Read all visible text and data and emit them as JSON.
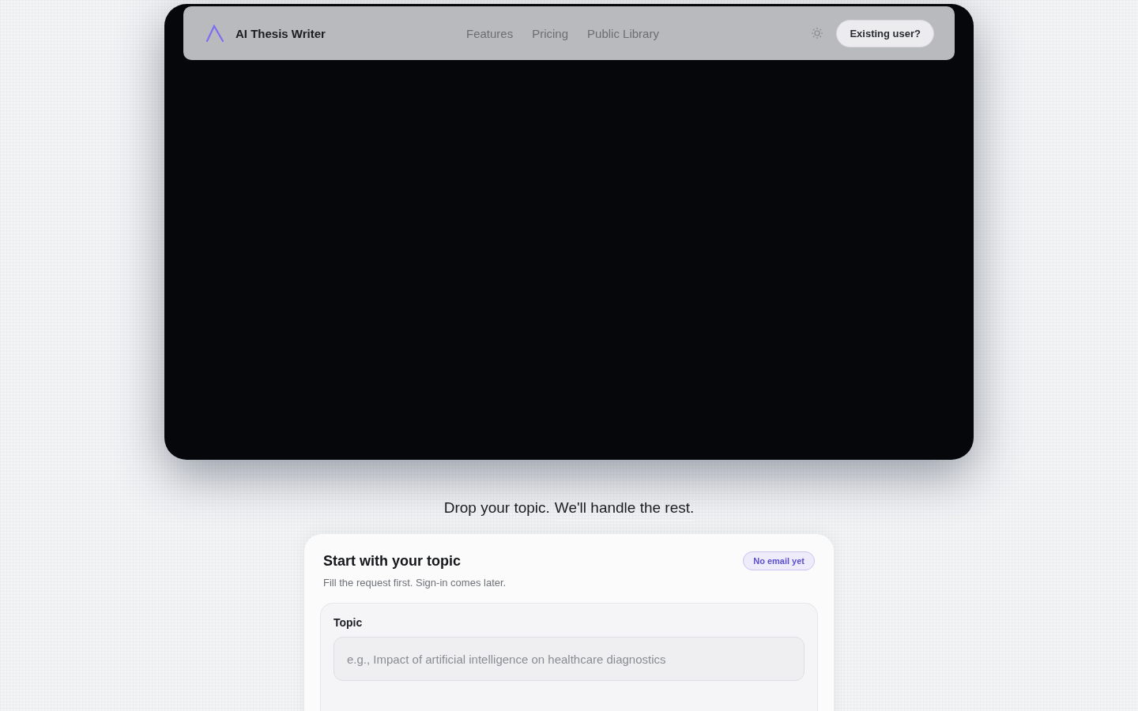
{
  "nav": {
    "brand": "AI Thesis Writer",
    "links": [
      {
        "label": "Features"
      },
      {
        "label": "Pricing"
      },
      {
        "label": "Public Library"
      }
    ],
    "cta": "Existing user?"
  },
  "tagline": {
    "lead": "Drop your topic.",
    "underlined": "We'll handle the rest."
  },
  "card": {
    "title": "Start with your topic",
    "badge": "No email yet",
    "subtitle": "Fill the request first. Sign-in comes later.",
    "topic": {
      "label": "Topic",
      "placeholder": "e.g., Impact of artificial intelligence on healthcare diagnostics"
    }
  }
}
